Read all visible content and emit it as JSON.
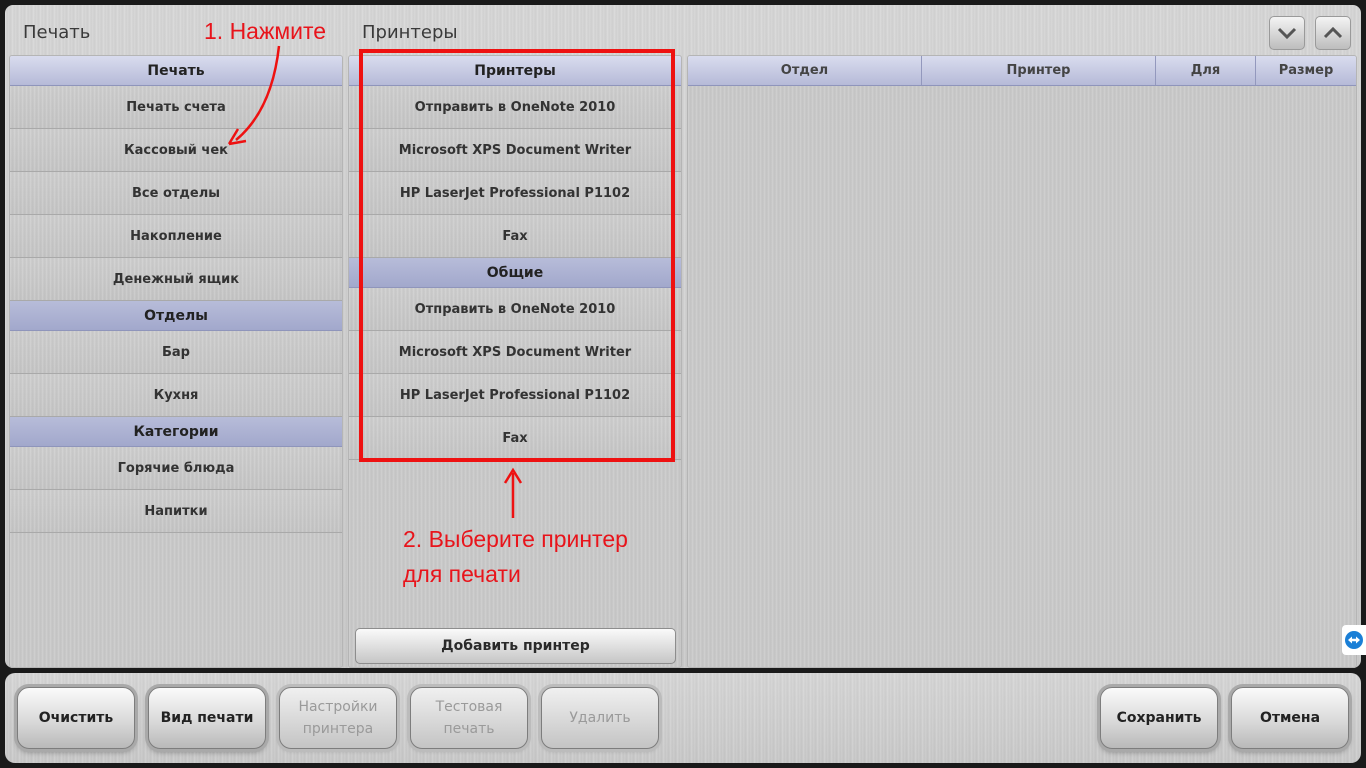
{
  "header": {
    "left_title": "Печать",
    "middle_title": "Принтеры",
    "scroll_down_icon": "chevron-down-icon",
    "scroll_up_icon": "chevron-up-icon"
  },
  "left_column": {
    "sections": [
      {
        "title": "Печать",
        "items": [
          "Печать счета",
          "Кассовый чек",
          "Все отделы",
          "Накопление",
          "Денежный ящик"
        ]
      },
      {
        "title": "Отделы",
        "items": [
          "Бар",
          "Кухня"
        ]
      },
      {
        "title": "Категории",
        "items": [
          "Горячие блюда",
          "Напитки"
        ]
      }
    ]
  },
  "printers_column": {
    "sections": [
      {
        "title": "Принтеры",
        "items": [
          "Отправить в OneNote 2010",
          "Microsoft XPS Document Writer",
          "HP LaserJet Professional P1102",
          "Fax"
        ]
      },
      {
        "title": "Общие",
        "items": [
          "Отправить в OneNote 2010",
          "Microsoft XPS Document Writer",
          "HP LaserJet Professional P1102",
          "Fax"
        ]
      }
    ],
    "add_button": "Добавить принтер"
  },
  "grid": {
    "columns": [
      "Отдел",
      "Принтер",
      "Для",
      "Размер"
    ]
  },
  "annotations": {
    "step1": "1. Нажмите",
    "step2_line1": "2. Выберите принтер",
    "step2_line2": "для печати",
    "color": "#e8141b"
  },
  "bottom_bar": {
    "clear": "Очистить",
    "print_view": "Вид печати",
    "printer_settings_l1": "Настройки",
    "printer_settings_l2": "принтера",
    "test_print_l1": "Тестовая",
    "test_print_l2": "печать",
    "delete": "Удалить",
    "save": "Сохранить",
    "cancel": "Отмена"
  },
  "colors": {
    "section_header": "#a2a8cc",
    "panel": "#cfcfcf",
    "annotation_red": "#ee1111"
  }
}
